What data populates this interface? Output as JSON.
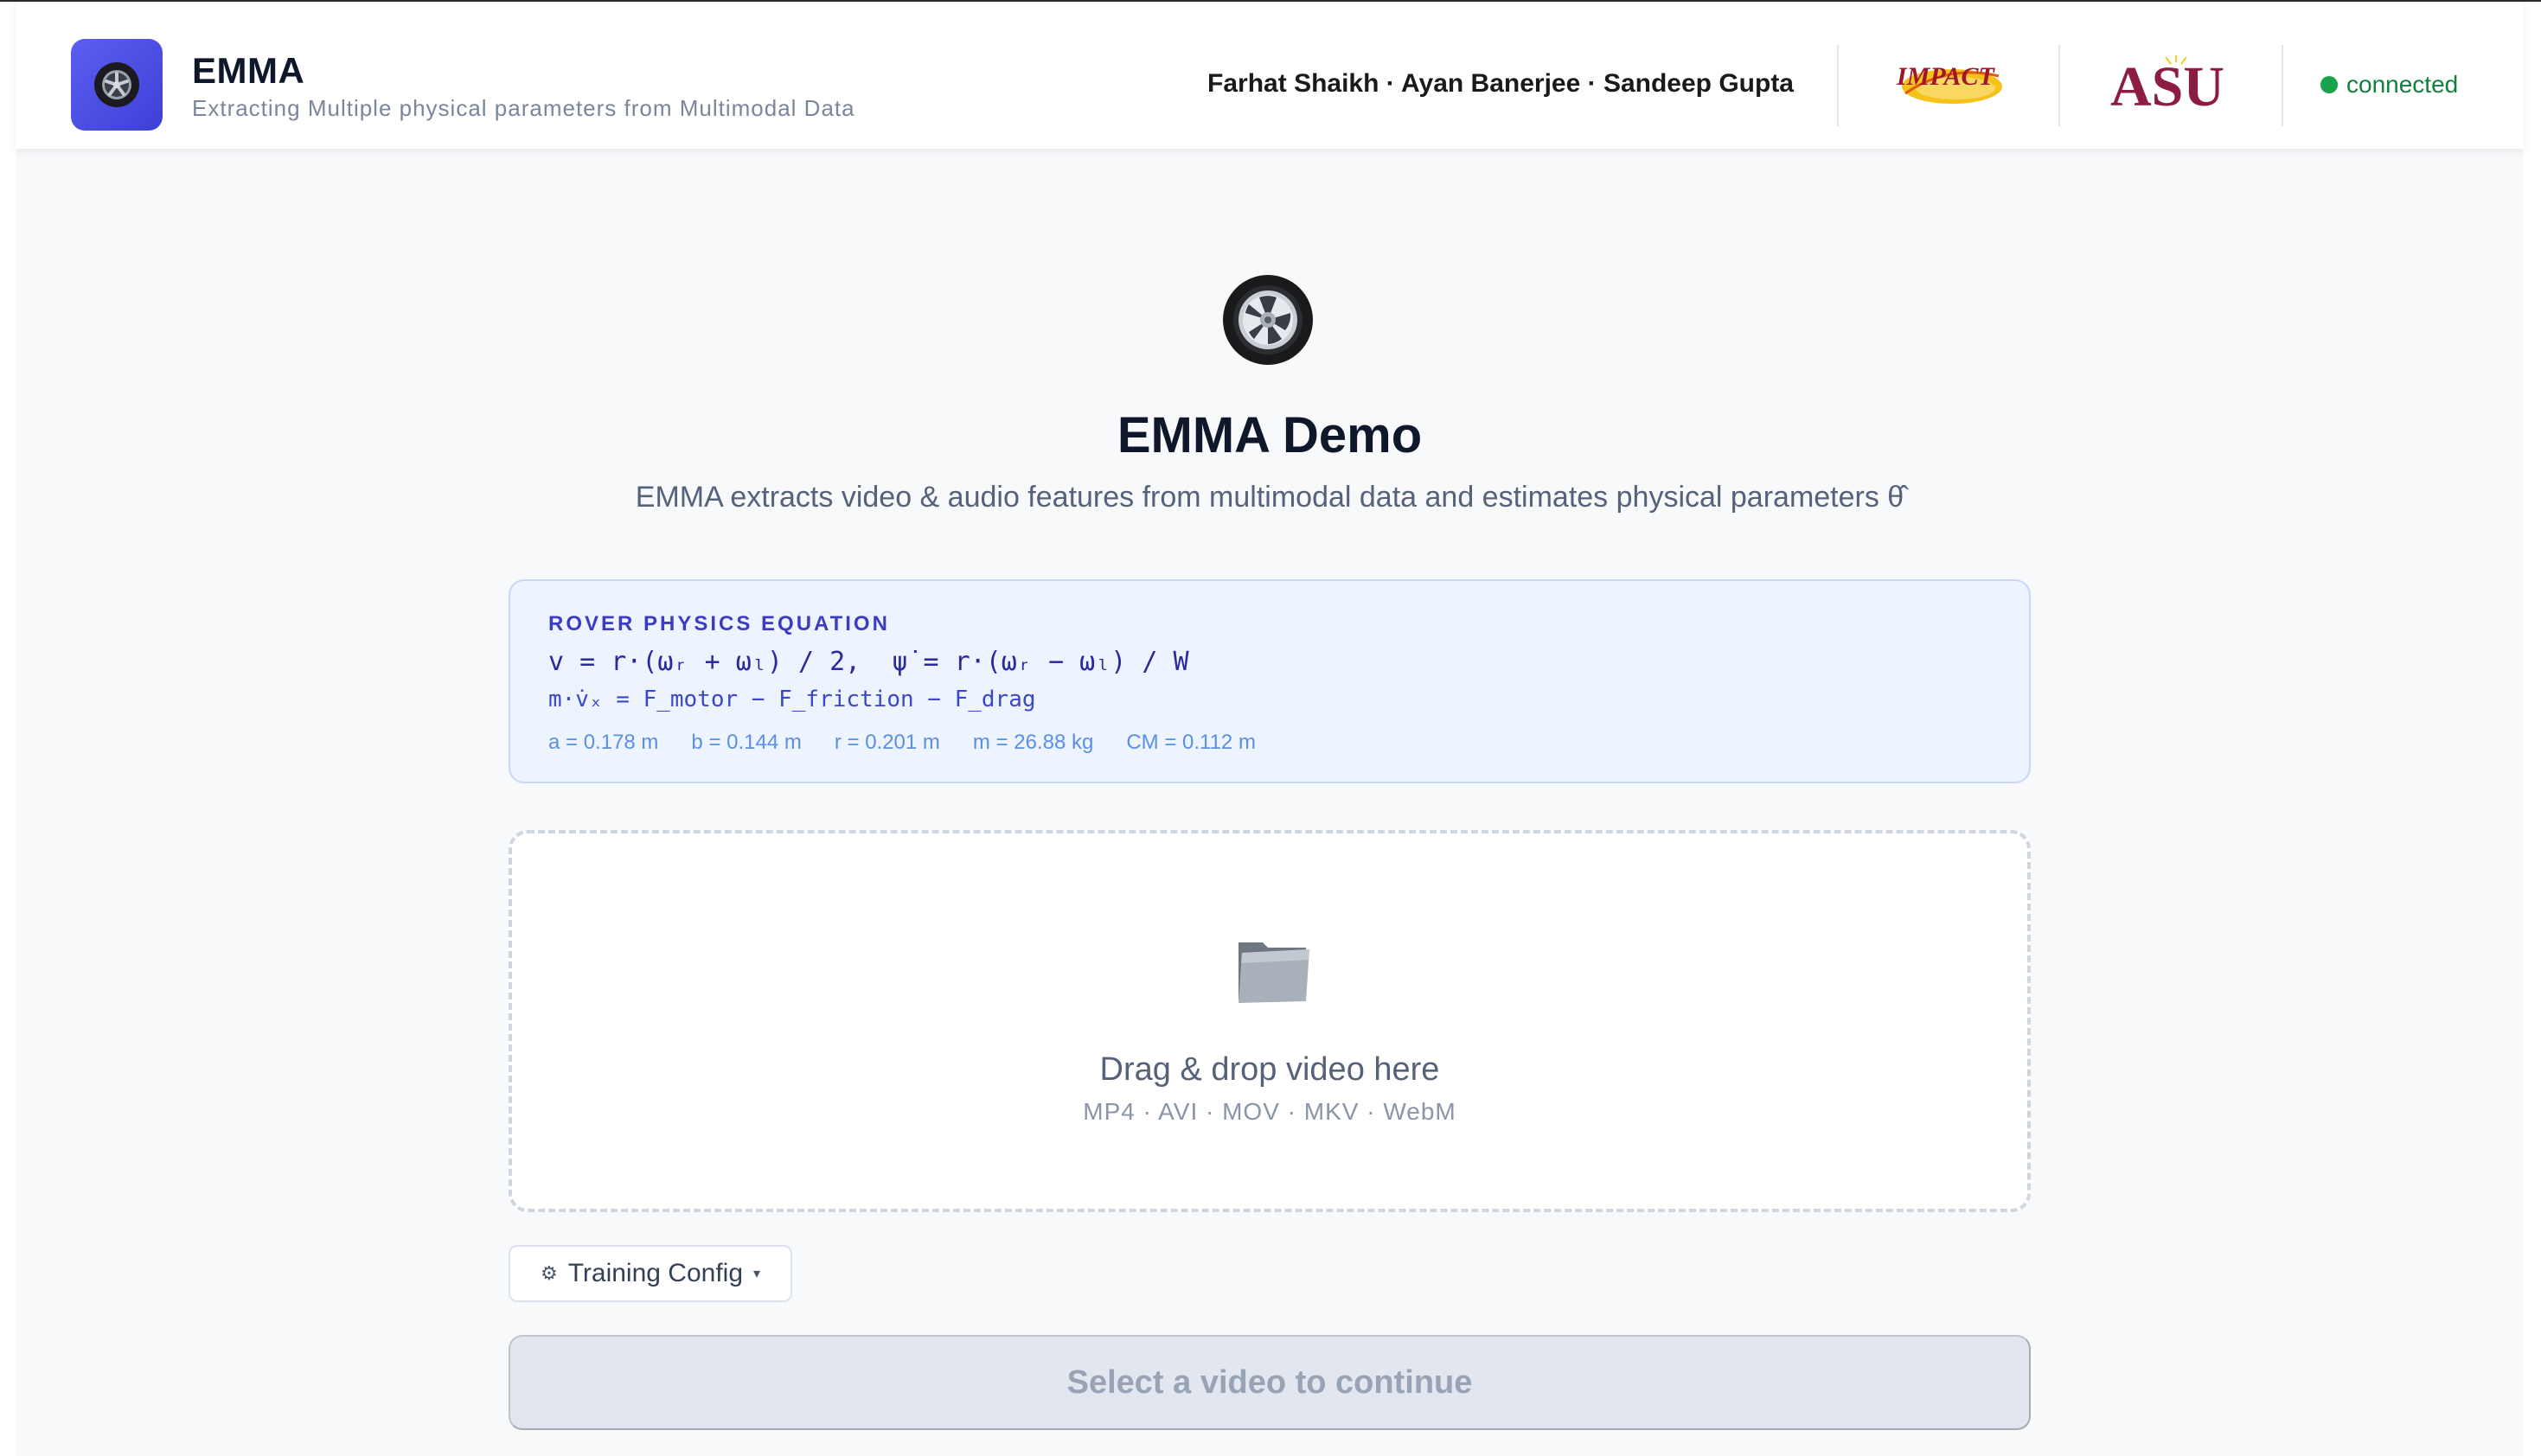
{
  "header": {
    "title": "EMMA",
    "subtitle": "Extracting Multiple physical parameters from Multimodal Data",
    "authors": "Farhat Shaikh · Ayan Banerjee · Sandeep Gupta",
    "logos": [
      "IMPACT",
      "ASU"
    ],
    "status": "connected",
    "status_color": "#16a34a",
    "app_icon": "wheel-icon"
  },
  "hero": {
    "icon": "wheel-icon",
    "title": "EMMA Demo",
    "subtitle": "EMMA extracts video & audio features from multimodal data and estimates physical parameters θ̂"
  },
  "equation": {
    "heading": "ROVER PHYSICS EQUATION",
    "line1": "v = r·(ωᵣ + ωₗ) / 2,  ψ̇ = r·(ωᵣ − ωₗ) / W",
    "line2": "m·v̇ₓ = F_motor − F_friction − F_drag",
    "params": [
      "a = 0.178 m",
      "b = 0.144 m",
      "r = 0.201 m",
      "m = 26.88 kg",
      "CM = 0.112 m"
    ]
  },
  "dropzone": {
    "icon": "folder-icon",
    "title": "Drag & drop video here",
    "formats": "MP4 · AVI · MOV · MKV · WebM"
  },
  "config": {
    "label": "Training Config",
    "gear": "⚙",
    "caret": "▾"
  },
  "cta": {
    "label": "Select a video to continue"
  },
  "colors": {
    "accent": "#4f52e6",
    "equation_bg": "#eef4ff",
    "cta_bg": "#e2e7ef"
  }
}
